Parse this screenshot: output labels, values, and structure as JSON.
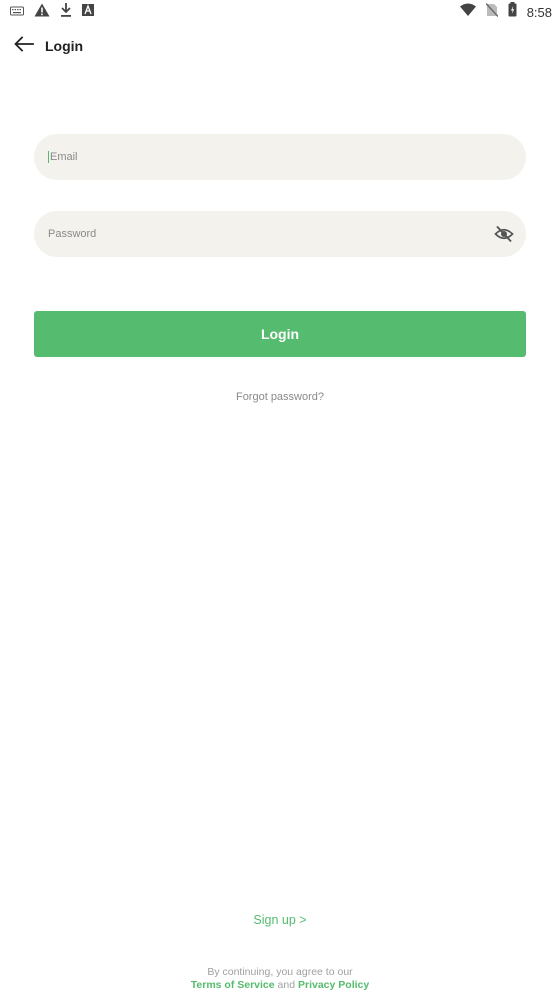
{
  "status_bar": {
    "time": "8:58",
    "left_icons": [
      "keyboard-icon",
      "warning-icon",
      "download-icon",
      "font-a-icon"
    ],
    "right_icons": [
      "wifi-icon",
      "no-sim-icon",
      "battery-icon"
    ]
  },
  "app_bar": {
    "title": "Login",
    "back_icon": "arrow-left-icon"
  },
  "form": {
    "email_placeholder": "Email",
    "email_value": "",
    "password_placeholder": "Password",
    "password_value": "",
    "visibility_icon": "eye-off-icon",
    "login_label": "Login",
    "forgot_label": "Forgot password?"
  },
  "footer": {
    "signup_label": "Sign up >",
    "legal_prefix": "By continuing, you agree to our",
    "terms_label": "Terms of Service",
    "and_label": "and",
    "privacy_label": "Privacy Policy"
  },
  "colors": {
    "accent": "#55bb6e",
    "field_bg": "#f3f2ec",
    "muted_text": "#8a8a8a"
  }
}
